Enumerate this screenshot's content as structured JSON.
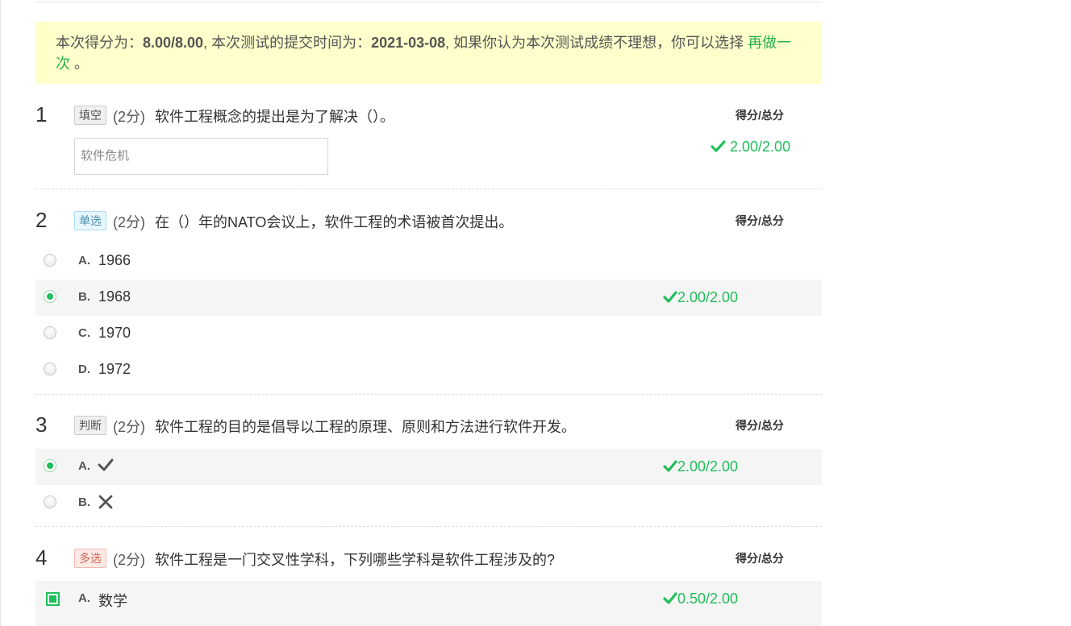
{
  "banner": {
    "prefix": "本次得分为：",
    "score": "8.00/8.00",
    "middle": ", 本次测试的提交时间为：",
    "date": "2021-03-08",
    "suffix": ", 如果你认为本次测试成绩不理想，你可以选择 ",
    "redo_link": "再做一次",
    "end": " 。"
  },
  "score_header": "得分/总分",
  "questions": [
    {
      "number": "1",
      "type": "填空",
      "points": "(2分)",
      "text": "软件工程概念的提出是为了解决（）。",
      "answer": "软件危机",
      "score": "2.00/2.00"
    },
    {
      "number": "2",
      "type": "单选",
      "points": "(2分)",
      "text": "在（）年的NATO会议上，软件工程的术语被首次提出。",
      "options": [
        {
          "letter": "A.",
          "text": "1966"
        },
        {
          "letter": "B.",
          "text": "1968",
          "selected": true,
          "score": "2.00/2.00"
        },
        {
          "letter": "C.",
          "text": "1970"
        },
        {
          "letter": "D.",
          "text": "1972"
        }
      ]
    },
    {
      "number": "3",
      "type": "判断",
      "points": "(2分)",
      "text": "软件工程的目的是倡导以工程的原理、原则和方法进行软件开发。",
      "options": [
        {
          "letter": "A.",
          "icon": "check-icon",
          "selected": true,
          "score": "2.00/2.00"
        },
        {
          "letter": "B.",
          "icon": "cross-icon"
        }
      ]
    },
    {
      "number": "4",
      "type": "多选",
      "points": "(2分)",
      "text": "软件工程是一门交叉性学科，下列哪些学科是软件工程涉及的?",
      "options": [
        {
          "letter": "A.",
          "text": "数学",
          "selected": true,
          "score": "0.50/2.00"
        }
      ]
    }
  ],
  "colors": {
    "accent_green": "#1fbf5a",
    "banner_bg": "#ffffcc"
  }
}
